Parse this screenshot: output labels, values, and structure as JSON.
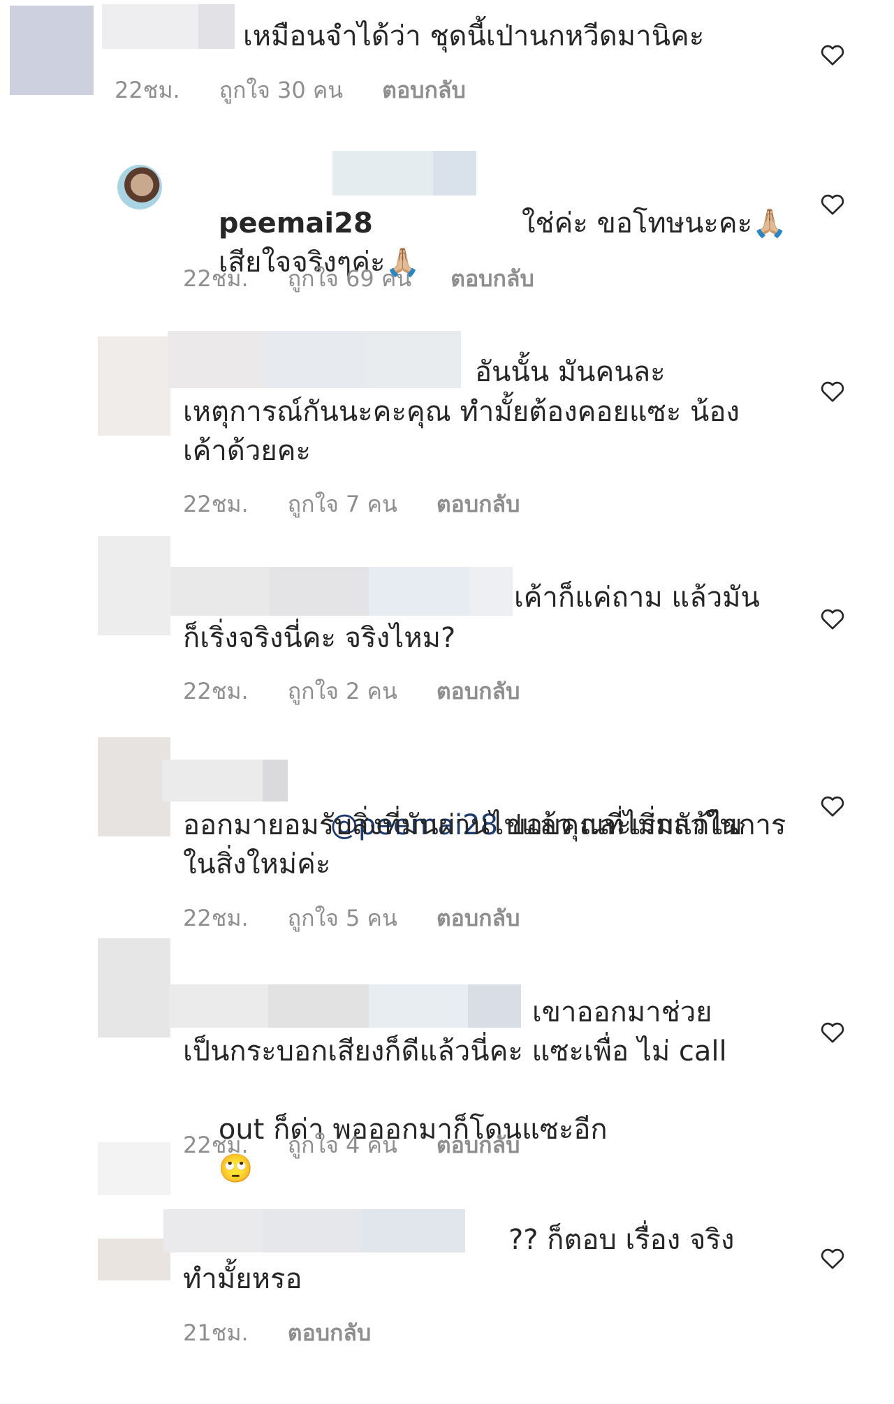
{
  "comments": [
    {
      "text": "เหมือนจำได้ว่า ชุดนี้เป่านกหวีดมานิคะ",
      "time": "22ชม.",
      "likes": "ถูกใจ 30 คน",
      "reply": "ตอบกลับ"
    },
    {
      "username": "peemai28",
      "text_line1": "ใช่ค่ะ ขอโทษนะคะ",
      "emoji1": "🙏🏼",
      "text_line2": "เสียใจจริงๆค่ะ",
      "emoji2": "🙏🏼",
      "time": "22ชม.",
      "likes": "ถูกใจ 69 คน",
      "reply": "ตอบกลับ"
    },
    {
      "text_line1": "อันนั้น มันคนละ",
      "text_line2": "เหตุการณ์กันนะคะคุณ ทำมั้ยต้องคอยแซะ น้อง",
      "text_line3": "เค้าด้วยคะ",
      "time": "22ชม.",
      "likes": "ถูกใจ 7 คน",
      "reply": "ตอบกลับ"
    },
    {
      "text_line1": "เค้าก็แค่ถาม แล้วมัน",
      "text_line2": "ก็เริ่งจริงนี่คะ จริงไหม?",
      "time": "22ชม.",
      "likes": "ถูกใจ 2 คน",
      "reply": "ตอบกลับ"
    },
    {
      "mention": "@peemai28",
      "text_line1": " ขอบคุณที่ไม่กลัวในการ",
      "text_line2": "ออกมายอมรับสิ่งที่มันผ่านไปแล้ว และเริ่มแก้ไข",
      "text_line3": "ในสิ่งใหม่ค่ะ",
      "time": "22ชม.",
      "likes": "ถูกใจ 5 คน",
      "reply": "ตอบกลับ"
    },
    {
      "text_line1": "เขาออกมาช่วย",
      "text_line2": "เป็นกระบอกเสียงก็ดีแล้วนี่คะ แซะเพื่อ ไม่ call",
      "text_line3": "out ก็ด่า พอออกมาก็โดนแซะอีก",
      "emoji": "🙄",
      "time": "22ชม.",
      "likes": "ถูกใจ 4 คน",
      "reply": "ตอบกลับ"
    },
    {
      "text_line1": "?? ก็ตอบ เรื่อง จริง",
      "text_line2": "ทำมั้ยหรอ",
      "time": "21ชม.",
      "reply": "ตอบกลับ"
    }
  ],
  "icons": {
    "like": "heart-outline-icon"
  },
  "colors": {
    "text": "#262626",
    "meta": "#8e8e8e",
    "mention": "#1d3b6f"
  }
}
